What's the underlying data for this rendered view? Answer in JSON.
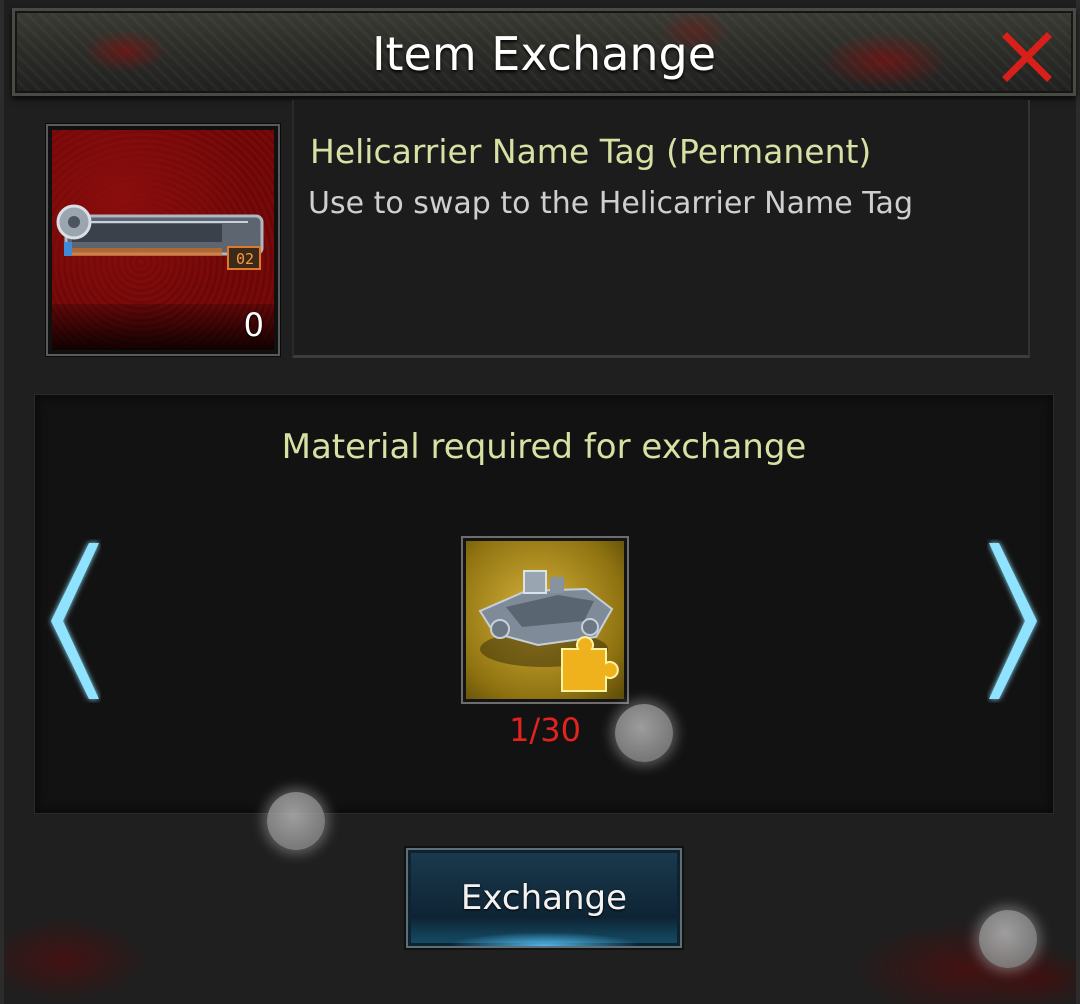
{
  "dialog": {
    "title": "Item Exchange",
    "close_icon": "close-x-icon"
  },
  "target_item": {
    "name": "Helicarrier Name Tag (Permanent)",
    "description": "Use to swap to the Helicarrier Name Tag",
    "owned_count": "0",
    "plate_label": "02",
    "icon": "helicarrier-name-tag-icon"
  },
  "material": {
    "heading": "Material required for exchange",
    "count": "1/30",
    "icon": "helicarrier-fragment-icon",
    "prev_icon": "chevron-left-icon",
    "next_icon": "chevron-right-icon"
  },
  "actions": {
    "exchange_label": "Exchange"
  },
  "colors": {
    "accent_text": "#d8e0a4",
    "count_insufficient": "#e2231f",
    "arrow_glow": "#8fe3ff",
    "close_red": "#d8201a"
  }
}
